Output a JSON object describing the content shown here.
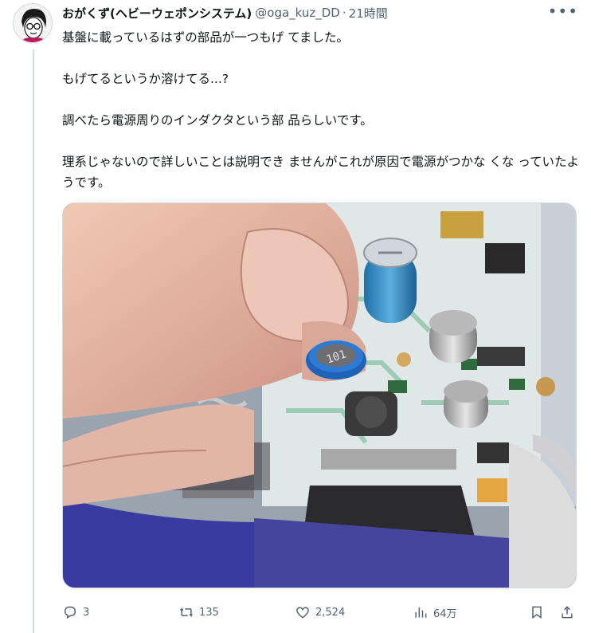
{
  "author": {
    "display_name": "おがくず(ヘビーウェポンシステム)",
    "handle": "@oga_kuz_DD",
    "separator": "·",
    "time": "21時間"
  },
  "more_label": "•••",
  "tweet": {
    "paragraphs": [
      "基盤に載っているはずの部品が一つもげ てました。",
      "もげてるというか溶けてる...?",
      "調べたら電源周りのインダクタという部 品らしいです。",
      "理系じゃないので詳しいことは説明でき ませんがこれが原因で電源がつかな くな っていたようです。"
    ]
  },
  "media": {
    "component_marking": "101"
  },
  "actions": {
    "reply_count": "3",
    "retweet_count": "135",
    "like_count": "2,524",
    "views_count": "64万"
  },
  "colors": {
    "text_primary": "#0f1419",
    "text_secondary": "#536471",
    "border": "#cfd9de"
  }
}
